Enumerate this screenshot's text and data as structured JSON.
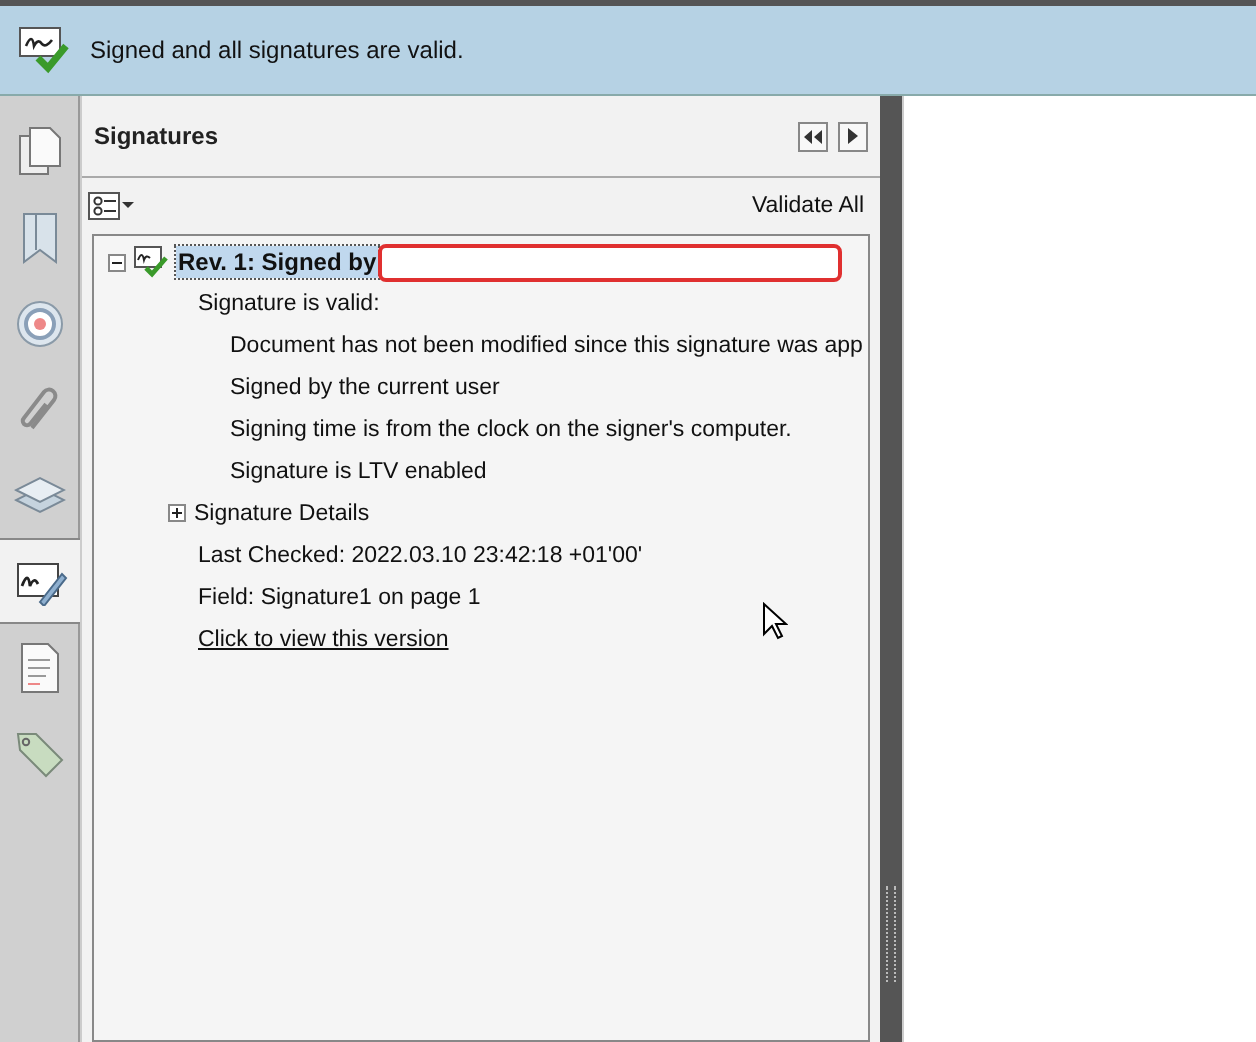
{
  "banner": {
    "message": "Signed and all signatures are valid."
  },
  "tool_rail": [
    {
      "kind": "pages",
      "selected": false
    },
    {
      "kind": "bookmark",
      "selected": false
    },
    {
      "kind": "target",
      "selected": false
    },
    {
      "kind": "paperclip",
      "selected": false
    },
    {
      "kind": "layers",
      "selected": false
    },
    {
      "kind": "signature",
      "selected": true
    },
    {
      "kind": "document",
      "selected": false
    },
    {
      "kind": "tag",
      "selected": false
    }
  ],
  "panel": {
    "title": "Signatures",
    "validate_all": "Validate All"
  },
  "tree": [
    {
      "label": "Rev. 1: Signed by",
      "expanded": true,
      "selected": true,
      "redacted": true,
      "children": [
        {
          "label": "Signature is valid:",
          "children": [
            {
              "label": "Document has not been modified since this signature was app"
            },
            {
              "label": "Signed by the current user"
            },
            {
              "label": "Signing time is from the clock on the signer's computer."
            },
            {
              "label": "Signature is LTV enabled"
            }
          ]
        },
        {
          "label": "Signature Details",
          "expanded": false
        },
        {
          "label": "Last Checked: 2022.03.10 23:42:18 +01'00'"
        },
        {
          "label": "Field: Signature1 on page 1"
        },
        {
          "label": "Click to view this version",
          "kind": "link"
        }
      ]
    }
  ]
}
